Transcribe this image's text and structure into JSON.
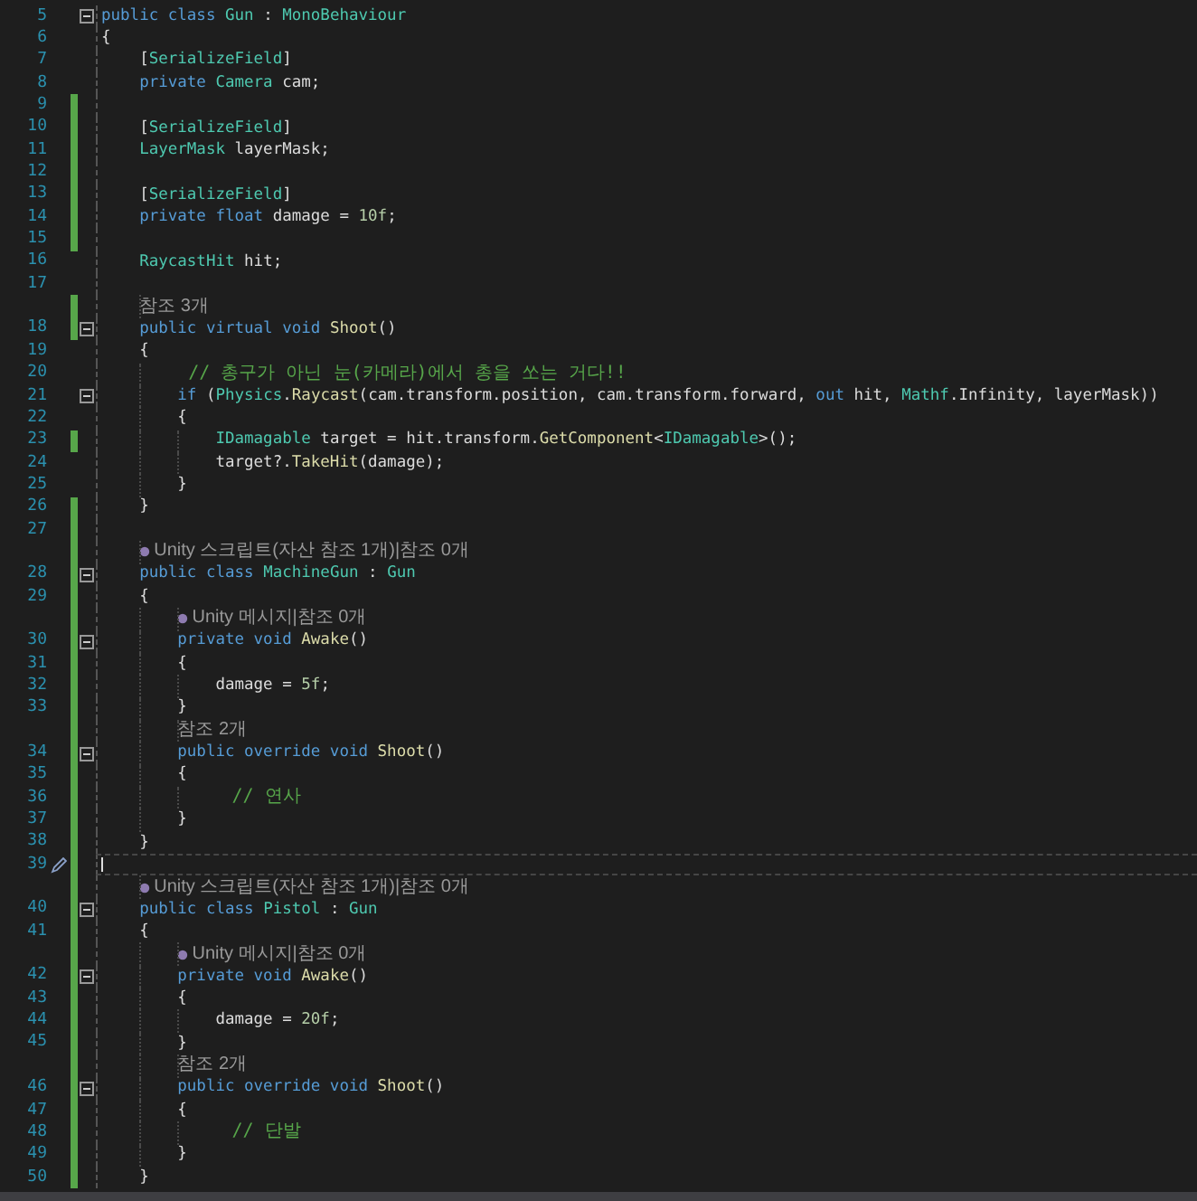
{
  "editor": {
    "lines": [
      {
        "kind": "code",
        "number": "5",
        "changed": false,
        "collapsible": true,
        "tokens": [
          {
            "text": "public class ",
            "kind": "keyword"
          },
          {
            "text": "Gun",
            "kind": "type"
          },
          {
            "text": " : ",
            "kind": "plain"
          },
          {
            "text": "MonoBehaviour",
            "kind": "type"
          }
        ]
      },
      {
        "kind": "code",
        "number": "6",
        "changed": false,
        "collapsible": false,
        "tokens": [
          {
            "text": "{",
            "kind": "plain"
          }
        ]
      },
      {
        "kind": "code",
        "number": "7",
        "changed": false,
        "collapsible": false,
        "tokens": [
          {
            "text": "    [",
            "kind": "plain"
          },
          {
            "text": "SerializeField",
            "kind": "type"
          },
          {
            "text": "]",
            "kind": "plain"
          }
        ]
      },
      {
        "kind": "code",
        "number": "8",
        "changed": false,
        "collapsible": false,
        "tokens": [
          {
            "text": "    private ",
            "kind": "keyword"
          },
          {
            "text": "Camera",
            "kind": "type"
          },
          {
            "text": " cam;",
            "kind": "plain"
          }
        ]
      },
      {
        "kind": "code",
        "number": "9",
        "changed": true,
        "collapsible": false
      },
      {
        "kind": "code",
        "number": "10",
        "changed": true,
        "collapsible": false,
        "tokens": [
          {
            "text": "    [",
            "kind": "plain"
          },
          {
            "text": "SerializeField",
            "kind": "type"
          },
          {
            "text": "]",
            "kind": "plain"
          }
        ]
      },
      {
        "kind": "code",
        "number": "11",
        "changed": true,
        "collapsible": false,
        "tokens": [
          {
            "text": "    LayerMask",
            "kind": "type"
          },
          {
            "text": " layerMask;",
            "kind": "plain"
          }
        ]
      },
      {
        "kind": "code",
        "number": "12",
        "changed": true,
        "collapsible": false
      },
      {
        "kind": "code",
        "number": "13",
        "changed": true,
        "collapsible": false,
        "tokens": [
          {
            "text": "    [",
            "kind": "plain"
          },
          {
            "text": "SerializeField",
            "kind": "type"
          },
          {
            "text": "]",
            "kind": "plain"
          }
        ]
      },
      {
        "kind": "code",
        "number": "14",
        "changed": true,
        "collapsible": false,
        "tokens": [
          {
            "text": "    private float",
            "kind": "keyword"
          },
          {
            "text": " damage = ",
            "kind": "plain"
          },
          {
            "text": "10f",
            "kind": "number"
          },
          {
            "text": ";",
            "kind": "plain"
          }
        ]
      },
      {
        "kind": "code",
        "number": "15",
        "changed": true,
        "collapsible": false
      },
      {
        "kind": "code",
        "number": "16",
        "changed": false,
        "collapsible": false,
        "tokens": [
          {
            "text": "    RaycastHit",
            "kind": "type"
          },
          {
            "text": " hit;",
            "kind": "plain"
          }
        ]
      },
      {
        "kind": "code",
        "number": "17",
        "changed": false,
        "collapsible": false
      },
      {
        "kind": "lens",
        "text": "참조 3개",
        "unity": false,
        "changed": true
      },
      {
        "kind": "code",
        "number": "18",
        "changed": true,
        "collapsible": true,
        "tokens": [
          {
            "text": "    public virtual void ",
            "kind": "keyword"
          },
          {
            "text": "Shoot",
            "kind": "method"
          },
          {
            "text": "()",
            "kind": "plain"
          }
        ]
      },
      {
        "kind": "code",
        "number": "19",
        "changed": false,
        "collapsible": false,
        "tokens": [
          {
            "text": "    {",
            "kind": "plain"
          }
        ]
      },
      {
        "kind": "code",
        "number": "20",
        "changed": false,
        "collapsible": false,
        "tokens": [
          {
            "text": "        // 총구가 아닌 눈(카메라)에서 총을 쏘는 거다!!",
            "kind": "comment"
          }
        ]
      },
      {
        "kind": "code",
        "number": "21",
        "changed": false,
        "collapsible": true,
        "tokens": [
          {
            "text": "        if",
            "kind": "keyword"
          },
          {
            "text": " (",
            "kind": "plain"
          },
          {
            "text": "Physics",
            "kind": "type"
          },
          {
            "text": ".",
            "kind": "plain"
          },
          {
            "text": "Raycast",
            "kind": "method"
          },
          {
            "text": "(cam.transform.position, cam.transform.forward, ",
            "kind": "plain"
          },
          {
            "text": "out",
            "kind": "keyword"
          },
          {
            "text": " hit, ",
            "kind": "plain"
          },
          {
            "text": "Mathf",
            "kind": "type"
          },
          {
            "text": ".Infinity, layerMask))",
            "kind": "plain"
          }
        ]
      },
      {
        "kind": "code",
        "number": "22",
        "changed": false,
        "collapsible": false,
        "tokens": [
          {
            "text": "        {",
            "kind": "plain"
          }
        ]
      },
      {
        "kind": "code",
        "number": "23",
        "changed": true,
        "collapsible": false,
        "tokens": [
          {
            "text": "            IDamagable",
            "kind": "type"
          },
          {
            "text": " target = hit.transform.",
            "kind": "plain"
          },
          {
            "text": "GetComponent",
            "kind": "method"
          },
          {
            "text": "<",
            "kind": "plain"
          },
          {
            "text": "IDamagable",
            "kind": "type"
          },
          {
            "text": ">();",
            "kind": "plain"
          }
        ]
      },
      {
        "kind": "code",
        "number": "24",
        "changed": false,
        "collapsible": false,
        "tokens": [
          {
            "text": "            target?.",
            "kind": "plain"
          },
          {
            "text": "TakeHit",
            "kind": "method"
          },
          {
            "text": "(damage);",
            "kind": "plain"
          }
        ]
      },
      {
        "kind": "code",
        "number": "25",
        "changed": false,
        "collapsible": false,
        "tokens": [
          {
            "text": "        }",
            "kind": "plain"
          }
        ]
      },
      {
        "kind": "code",
        "number": "26",
        "changed": true,
        "collapsible": false,
        "tokens": [
          {
            "text": "    }",
            "kind": "plain"
          }
        ]
      },
      {
        "kind": "code",
        "number": "27",
        "changed": true,
        "collapsible": false
      },
      {
        "kind": "lens",
        "text": "Unity 스크립트(자산 참조 1개)|참조 0개",
        "unity": true,
        "changed": true
      },
      {
        "kind": "code",
        "number": "28",
        "changed": true,
        "collapsible": true,
        "tokens": [
          {
            "text": "    public class ",
            "kind": "keyword"
          },
          {
            "text": "MachineGun",
            "kind": "type"
          },
          {
            "text": " : ",
            "kind": "plain"
          },
          {
            "text": "Gun",
            "kind": "type"
          }
        ]
      },
      {
        "kind": "code",
        "number": "29",
        "changed": true,
        "collapsible": false,
        "tokens": [
          {
            "text": "    {",
            "kind": "plain"
          }
        ]
      },
      {
        "kind": "lens",
        "text": "Unity 메시지|참조 0개",
        "unity": true,
        "changed": true
      },
      {
        "kind": "code",
        "number": "30",
        "changed": true,
        "collapsible": true,
        "tokens": [
          {
            "text": "        private void ",
            "kind": "keyword"
          },
          {
            "text": "Awake",
            "kind": "method"
          },
          {
            "text": "()",
            "kind": "plain"
          }
        ]
      },
      {
        "kind": "code",
        "number": "31",
        "changed": true,
        "collapsible": false,
        "tokens": [
          {
            "text": "        {",
            "kind": "plain"
          }
        ]
      },
      {
        "kind": "code",
        "number": "32",
        "changed": true,
        "collapsible": false,
        "tokens": [
          {
            "text": "            damage = ",
            "kind": "plain"
          },
          {
            "text": "5f",
            "kind": "number"
          },
          {
            "text": ";",
            "kind": "plain"
          }
        ]
      },
      {
        "kind": "code",
        "number": "33",
        "changed": true,
        "collapsible": false,
        "tokens": [
          {
            "text": "        }",
            "kind": "plain"
          }
        ]
      },
      {
        "kind": "lens",
        "text": "참조 2개",
        "unity": false,
        "changed": true
      },
      {
        "kind": "code",
        "number": "34",
        "changed": true,
        "collapsible": true,
        "tokens": [
          {
            "text": "        public override void ",
            "kind": "keyword"
          },
          {
            "text": "Shoot",
            "kind": "method"
          },
          {
            "text": "()",
            "kind": "plain"
          }
        ]
      },
      {
        "kind": "code",
        "number": "35",
        "changed": true,
        "collapsible": false,
        "tokens": [
          {
            "text": "        {",
            "kind": "plain"
          }
        ]
      },
      {
        "kind": "code",
        "number": "36",
        "changed": true,
        "collapsible": false,
        "tokens": [
          {
            "text": "            // 연사",
            "kind": "comment"
          }
        ]
      },
      {
        "kind": "code",
        "number": "37",
        "changed": true,
        "collapsible": false,
        "tokens": [
          {
            "text": "        }",
            "kind": "plain"
          }
        ]
      },
      {
        "kind": "code",
        "number": "38",
        "changed": true,
        "collapsible": false,
        "tokens": [
          {
            "text": "    }",
            "kind": "plain"
          }
        ]
      },
      {
        "kind": "code",
        "number": "39",
        "changed": true,
        "collapsible": false,
        "current": true
      },
      {
        "kind": "lens",
        "text": "Unity 스크립트(자산 참조 1개)|참조 0개",
        "unity": true,
        "changed": true
      },
      {
        "kind": "code",
        "number": "40",
        "changed": true,
        "collapsible": true,
        "tokens": [
          {
            "text": "    public class ",
            "kind": "keyword"
          },
          {
            "text": "Pistol",
            "kind": "type"
          },
          {
            "text": " : ",
            "kind": "plain"
          },
          {
            "text": "Gun",
            "kind": "type"
          }
        ]
      },
      {
        "kind": "code",
        "number": "41",
        "changed": true,
        "collapsible": false,
        "tokens": [
          {
            "text": "    {",
            "kind": "plain"
          }
        ]
      },
      {
        "kind": "lens",
        "text": "Unity 메시지|참조 0개",
        "unity": true,
        "changed": true
      },
      {
        "kind": "code",
        "number": "42",
        "changed": true,
        "collapsible": true,
        "tokens": [
          {
            "text": "        private void ",
            "kind": "keyword"
          },
          {
            "text": "Awake",
            "kind": "method"
          },
          {
            "text": "()",
            "kind": "plain"
          }
        ]
      },
      {
        "kind": "code",
        "number": "43",
        "changed": true,
        "collapsible": false,
        "tokens": [
          {
            "text": "        {",
            "kind": "plain"
          }
        ]
      },
      {
        "kind": "code",
        "number": "44",
        "changed": true,
        "collapsible": false,
        "tokens": [
          {
            "text": "            damage = ",
            "kind": "plain"
          },
          {
            "text": "20f",
            "kind": "number"
          },
          {
            "text": ";",
            "kind": "plain"
          }
        ]
      },
      {
        "kind": "code",
        "number": "45",
        "changed": true,
        "collapsible": false,
        "tokens": [
          {
            "text": "        }",
            "kind": "plain"
          }
        ]
      },
      {
        "kind": "lens",
        "text": "참조 2개",
        "unity": false,
        "changed": true
      },
      {
        "kind": "code",
        "number": "46",
        "changed": true,
        "collapsible": true,
        "tokens": [
          {
            "text": "        public override void ",
            "kind": "keyword"
          },
          {
            "text": "Shoot",
            "kind": "method"
          },
          {
            "text": "()",
            "kind": "plain"
          }
        ]
      },
      {
        "kind": "code",
        "number": "47",
        "changed": true,
        "collapsible": false,
        "tokens": [
          {
            "text": "        {",
            "kind": "plain"
          }
        ]
      },
      {
        "kind": "code",
        "number": "48",
        "changed": true,
        "collapsible": false,
        "tokens": [
          {
            "text": "            // 단발",
            "kind": "comment"
          }
        ]
      },
      {
        "kind": "code",
        "number": "49",
        "changed": true,
        "collapsible": false,
        "tokens": [
          {
            "text": "        }",
            "kind": "plain"
          }
        ]
      },
      {
        "kind": "code",
        "number": "50",
        "changed": true,
        "collapsible": false,
        "tokens": [
          {
            "text": "    }",
            "kind": "plain"
          }
        ]
      }
    ]
  }
}
